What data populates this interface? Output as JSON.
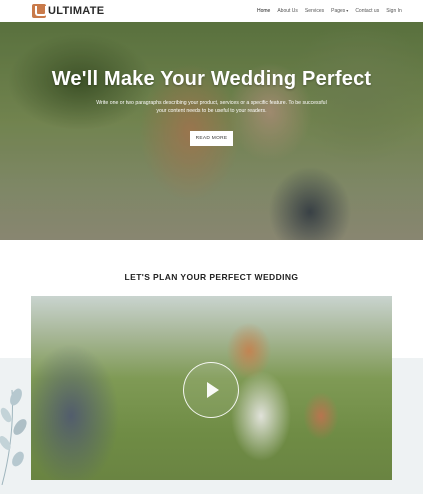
{
  "header": {
    "logo_text": "ULTIMATE",
    "nav": [
      {
        "label": "Home"
      },
      {
        "label": "About Us"
      },
      {
        "label": "Services"
      },
      {
        "label": "Pages",
        "caret": "▾"
      },
      {
        "label": "Contact us"
      },
      {
        "label": "Sign In"
      }
    ]
  },
  "hero": {
    "title": "We'll Make Your Wedding Perfect",
    "subtitle": "Write one or two paragraphs describing your product, services or a specific feature. To be successful your content needs to be useful to your readers.",
    "button_label": "READ MORE"
  },
  "section": {
    "title": "LET'S PLAN YOUR PERFECT WEDDING"
  },
  "icons": {
    "logo": "logo-mark-icon",
    "play": "play-icon",
    "leaf": "leaf-decoration-icon"
  },
  "colors": {
    "brand": "#c97a4a",
    "decor_bg": "#eef2f3"
  }
}
